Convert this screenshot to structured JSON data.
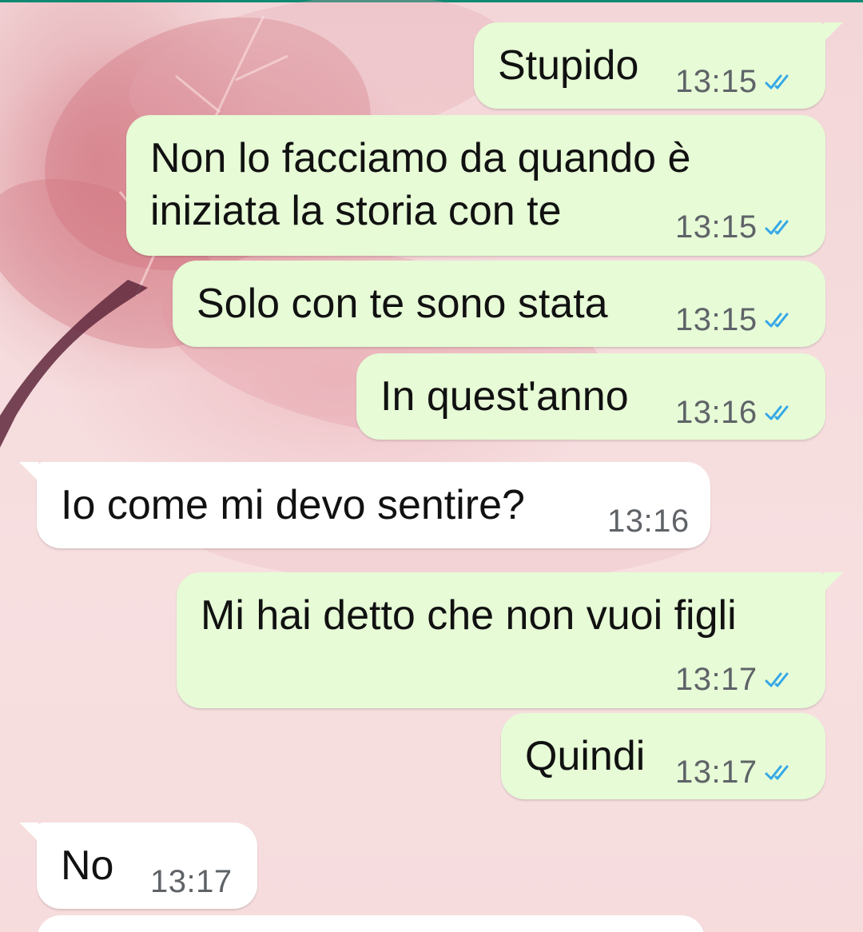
{
  "colors": {
    "outgoing_bubble": "#e6fbd6",
    "incoming_bubble": "#ffffff",
    "read_ticks": "#33a7e8",
    "timestamp": "#5f6368",
    "header_line": "#0f8a72"
  },
  "messages": [
    {
      "direction": "outgoing",
      "text": "Stupido",
      "time": "13:15",
      "status_icon": "double-check-read-icon"
    },
    {
      "direction": "outgoing",
      "line1": "Non lo facciamo da quando è",
      "line2": "iniziata la storia con te",
      "time": "13:15",
      "status_icon": "double-check-read-icon"
    },
    {
      "direction": "outgoing",
      "text": "Solo con te sono stata",
      "time": "13:15",
      "status_icon": "double-check-read-icon"
    },
    {
      "direction": "outgoing",
      "text": "In quest'anno",
      "time": "13:16",
      "status_icon": "double-check-read-icon"
    },
    {
      "direction": "incoming",
      "text": "Io come mi devo sentire?",
      "time": "13:16"
    },
    {
      "direction": "outgoing",
      "text": "Mi hai detto che non vuoi figli",
      "time": "13:17",
      "status_icon": "double-check-read-icon"
    },
    {
      "direction": "outgoing",
      "text": "Quindi",
      "time": "13:17",
      "status_icon": "double-check-read-icon"
    },
    {
      "direction": "incoming",
      "text": "No",
      "time": "13:17"
    }
  ]
}
